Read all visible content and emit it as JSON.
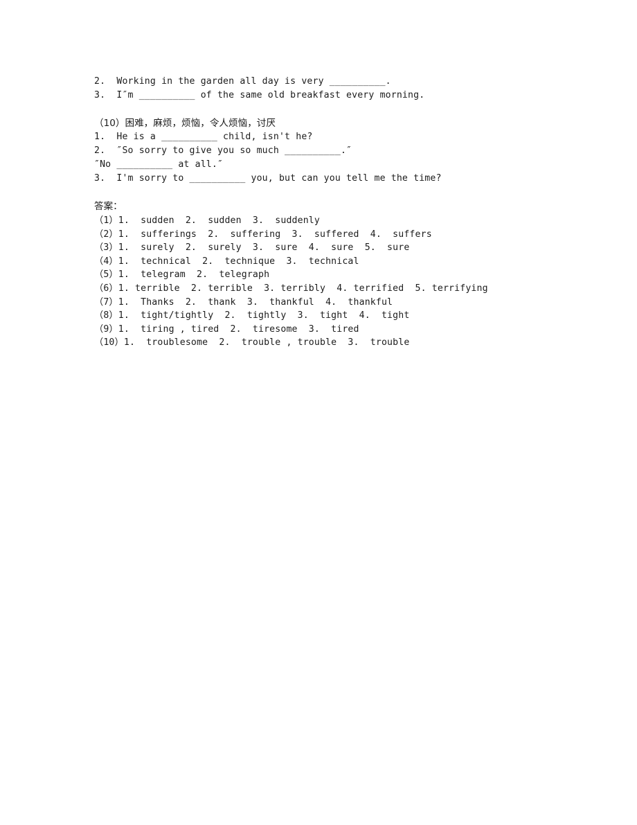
{
  "document": {
    "background_color": "#ffffff",
    "text_color": "#1c1c1c"
  },
  "exercise_top": {
    "items": [
      "2.  Working in the garden all day is very __________.",
      "3.  I″m __________ of the same old breakfast every morning."
    ]
  },
  "section_10": {
    "heading": "（10）困难，麻烦，烦恼，令人烦恼，讨厌",
    "items": [
      "1.  He is a __________ child, isn't he?",
      "2.  ″So sorry to give you so much __________.″",
      "″No __________ at all.″",
      "3.  I'm sorry to __________ you, but can you tell me the time?"
    ]
  },
  "answers": {
    "title": "答案：",
    "lines": [
      "（1）1.  sudden  2.  sudden  3.  suddenly",
      "（2）1.  sufferings  2.  suffering  3.  suffered  4.  suffers",
      "（3）1.  surely  2.  surely  3.  sure  4.  sure  5.  sure",
      "（4）1.  technical  2.  technique  3.  technical",
      "（5）1.  telegram  2.  telegraph",
      "（6）1. terrible  2. terrible  3. terribly  4. terrified  5. terrifying",
      "（7）1.  Thanks  2.  thank  3.  thankful  4.  thankful",
      "（8）1.  tight/tightly  2.  tightly  3.  tight  4.  tight",
      "（9）1.  tiring , tired  2.  tiresome  3.  tired",
      "（10）1.  troublesome  2.  trouble , trouble  3.  trouble"
    ]
  }
}
